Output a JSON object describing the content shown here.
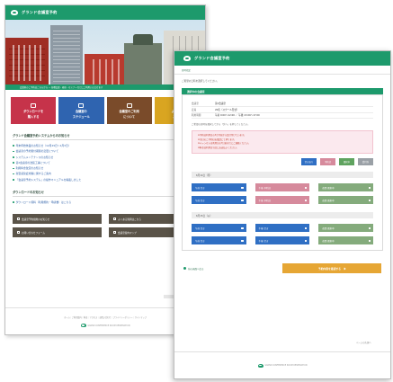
{
  "brand": {
    "logo_text": "グランド会議室予約",
    "green": "#1d9a6c"
  },
  "back": {
    "hero_caption": "会議室のご予約はこちらから — 各種会議・研修・セミナーなどにご利用いただけます",
    "tiles": [
      {
        "line1": "ダウンロードを",
        "line2": "購入する",
        "color": "#c6334a",
        "icon": "cart-icon"
      },
      {
        "line1": "会議室の",
        "line2": "スケジュール",
        "color": "#2f64b0",
        "icon": "calendar-icon"
      },
      {
        "line1": "会議室のご利用",
        "line2": "について",
        "color": "#7a4b2a",
        "icon": "info-icon"
      },
      {
        "line1": "よくある",
        "line2": "ご質問",
        "color": "#d9a521",
        "icon": "question-icon"
      }
    ],
    "news_title": "グランド会議室予約システムからのお知らせ",
    "news_items": [
      "年末年始休業のお知らせ（12月29日〜1月3日）",
      "会議室の予約受付期間の変更について",
      "システムメンテナンスのお知らせ",
      "第2会議室の改装工事について",
      "利用料金改定のお知らせ",
      "新型感染症対策に関するご案内",
      "「会議室予約システム」の操作マニュアルを掲載しました"
    ],
    "support_title": "ダウンロードのお知らせ",
    "support_items": [
      "ダウンロード資料（利用規約・申請書）はこちら"
    ],
    "banners": [
      "会議室予約規約のお知らせ",
      "よくある質問はこちら",
      "お問い合わせフォーム",
      "会議室案内マップ"
    ],
    "footer_links": "ホーム｜ご利用案内｜料金｜アクセス｜お問い合わせ｜プライバシーポリシー｜サイトマップ",
    "footer_logo": "GRAND CONFERENCE ROOM RESERVATION"
  },
  "front": {
    "crumb": "日時指定",
    "instruction": "ご希望の日時を選択してください。",
    "panel_title": "選択中の会議室",
    "info_rows": [
      {
        "key": "会議室",
        "value": "第1会議室"
      },
      {
        "key": "定員",
        "value": "20名（スクール形式）"
      },
      {
        "key": "利用時間",
        "value": "午前 9:00〜12:00 ／ 午後 13:00〜17:00"
      }
    ],
    "note": "ご希望の日時を選択してから「次へ」を押してください。",
    "warnings": [
      "※予約は利用日の3か月前から受け付けています。",
      "※当日のご予約はお電話にて承ります。",
      "※キャンセルは利用日の7日前までにご連絡ください。",
      "※料金は利用日当日にお支払いください。"
    ],
    "legend": [
      {
        "label": "空きあり",
        "color": "#2f6fc4"
      },
      {
        "label": "予約済",
        "color": "#d68a9c"
      },
      {
        "label": "選択中",
        "color": "#5fa35f"
      },
      {
        "label": "受付外",
        "color": "#9aa0a6"
      }
    ],
    "weeks": [
      {
        "header": "6月14日（月）",
        "slots": [
          {
            "label": "午前 空き",
            "state": "open"
          },
          {
            "label": "午後 予約済",
            "state": "booked"
          },
          {
            "label": "夜間 選択中",
            "state": "selected"
          },
          {
            "label": "午前 空き",
            "state": "open"
          },
          {
            "label": "午後 予約済",
            "state": "booked"
          },
          {
            "label": "夜間 選択中",
            "state": "selected"
          }
        ]
      },
      {
        "header": "6月15日（火）",
        "slots": [
          {
            "label": "午前 空き",
            "state": "open"
          },
          {
            "label": "午後 空き",
            "state": "open"
          },
          {
            "label": "夜間 選択中",
            "state": "selected"
          },
          {
            "label": "午前 空き",
            "state": "open"
          },
          {
            "label": "午後 空き",
            "state": "open"
          },
          {
            "label": "夜間 選択中",
            "state": "selected"
          }
        ]
      }
    ],
    "back_label": "前の画面へ戻る",
    "confirm_label": "予約内容を確認する",
    "page_top": "ページの先頭へ",
    "footer_logo": "GRAND CONFERENCE ROOM RESERVATION"
  }
}
